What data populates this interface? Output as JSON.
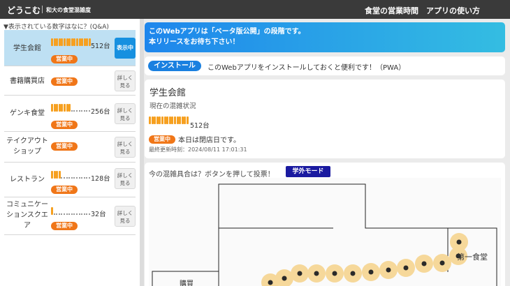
{
  "header": {
    "brand": "どうこむ",
    "subtitle": "和大の食堂混雑度",
    "nav": [
      "食堂の営業時間",
      "アプリの使い方"
    ]
  },
  "sidebar": {
    "question_link": "▼表示されている数字はなに？(Q&A)",
    "items": [
      {
        "name": "学生会館",
        "count_label": "512台",
        "level": 16,
        "status": "営業中",
        "button": "表示中",
        "active": true
      },
      {
        "name": "書籍購買店",
        "count_label": "",
        "level": 0,
        "status": "営業中",
        "button": "詳しく見る",
        "active": false
      },
      {
        "name": "ゲンキ食堂",
        "count_label": "256台",
        "level": 8,
        "status": "営業中",
        "button": "詳しく見る",
        "active": false
      },
      {
        "name": "テイクアウトショップ",
        "count_label": "",
        "level": 0,
        "status": "営業中",
        "button": "詳しく見る",
        "active": false
      },
      {
        "name": "レストラン",
        "count_label": "128台",
        "level": 4,
        "status": "営業中",
        "button": "詳しく見る",
        "active": false
      },
      {
        "name": "コミュニケーションスクエア",
        "count_label": "32台",
        "level": 1,
        "status": "営業中",
        "button": "詳しく見る",
        "active": false
      }
    ]
  },
  "notice": {
    "line1": "このWebアプリは「ベータ版公開」の段階です。",
    "line2": "本リリースをお待ち下さい！"
  },
  "install": {
    "button": "インストール",
    "text": "このWebアプリをインストールしておくと便利です！（PWA）"
  },
  "status_card": {
    "title": "学生会館",
    "subtitle": "現在の混雑状況",
    "count_label": "512台",
    "level": 16,
    "status": "営業中",
    "note": "本日は閉店日です。",
    "updated": "最終更新時刻：2024/08/11 17:01:31"
  },
  "vote": {
    "question": "今の混雑具合は？ボタンを押して投票！",
    "mode": "学外モード"
  },
  "map": {
    "labels": {
      "first_cafeteria": "第一食堂",
      "partial": "購買"
    }
  },
  "colors": {
    "topbar": "#3a3a3a",
    "accent_blue": "#1a80e0",
    "status_orange": "#f07618",
    "meter_orange": "#f6a020",
    "heat_ring": "#f6d89a"
  },
  "icons": {
    "question_toggle": "triangle-down-icon"
  }
}
